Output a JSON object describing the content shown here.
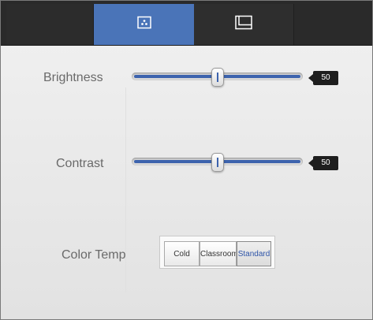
{
  "tabs": [
    {
      "id": "tab-blank-left",
      "icon": "",
      "active": false
    },
    {
      "id": "tab-image",
      "icon": "image-adjust-icon",
      "active": true
    },
    {
      "id": "tab-layout",
      "icon": "layout-icon",
      "active": false
    },
    {
      "id": "tab-blank-right",
      "icon": "",
      "active": false
    }
  ],
  "brightness": {
    "label": "Brightness",
    "value": 50,
    "value_text": "50",
    "range": [
      0,
      100
    ]
  },
  "contrast": {
    "label": "Contrast",
    "value": 50,
    "value_text": "50",
    "range": [
      0,
      100
    ]
  },
  "color_temp": {
    "label": "Color Temp",
    "options": [
      "Cold",
      "Classroom",
      "Standard"
    ],
    "selected": "Standard"
  },
  "colors": {
    "accent": "#4a74b8",
    "slider_fill": "#3d63ad",
    "tabbar": "#2a2a2a",
    "badge": "#1e1e1e"
  }
}
